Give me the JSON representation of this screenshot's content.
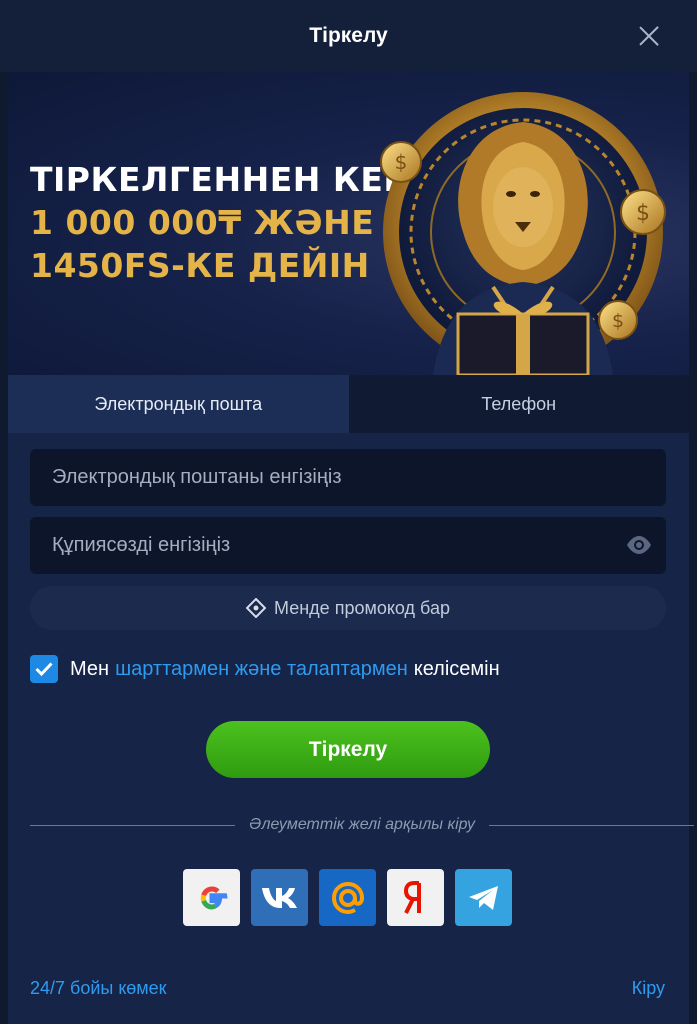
{
  "header": {
    "title": "Тіркелу"
  },
  "banner": {
    "line1": "ТІРКЕЛГЕННЕН КЕЙІН",
    "line2": "1 000 000₸ ЖӘНЕ",
    "line3": "1450FS-КЕ ДЕЙІН",
    "colors": {
      "white": "#ffffff",
      "gold": "#e4b448"
    }
  },
  "tabs": [
    {
      "label": "Электрондық пошта",
      "active": true
    },
    {
      "label": "Телефон",
      "active": false
    }
  ],
  "fields": {
    "email_placeholder": "Электрондық поштаны енгізіңіз",
    "password_placeholder": "Құпиясөзді енгізіңіз"
  },
  "promo": {
    "label": "Менде промокод бар",
    "icon": "ticket-icon"
  },
  "agreement": {
    "prefix": "Мен",
    "link": "шарттармен және талаптармен",
    "suffix": "келісемін",
    "checked": true
  },
  "submit": {
    "label": "Тіркелу",
    "color": "#3fb317"
  },
  "social": {
    "divider_label": "Әлеуметтік желі арқылы кіру",
    "providers": [
      "google-icon",
      "vk-icon",
      "mail-ru-icon",
      "yandex-icon",
      "telegram-icon"
    ]
  },
  "footer": {
    "help": "24/7 бойы көмек",
    "login": "Кіру"
  },
  "accent": "#2f9bf0"
}
